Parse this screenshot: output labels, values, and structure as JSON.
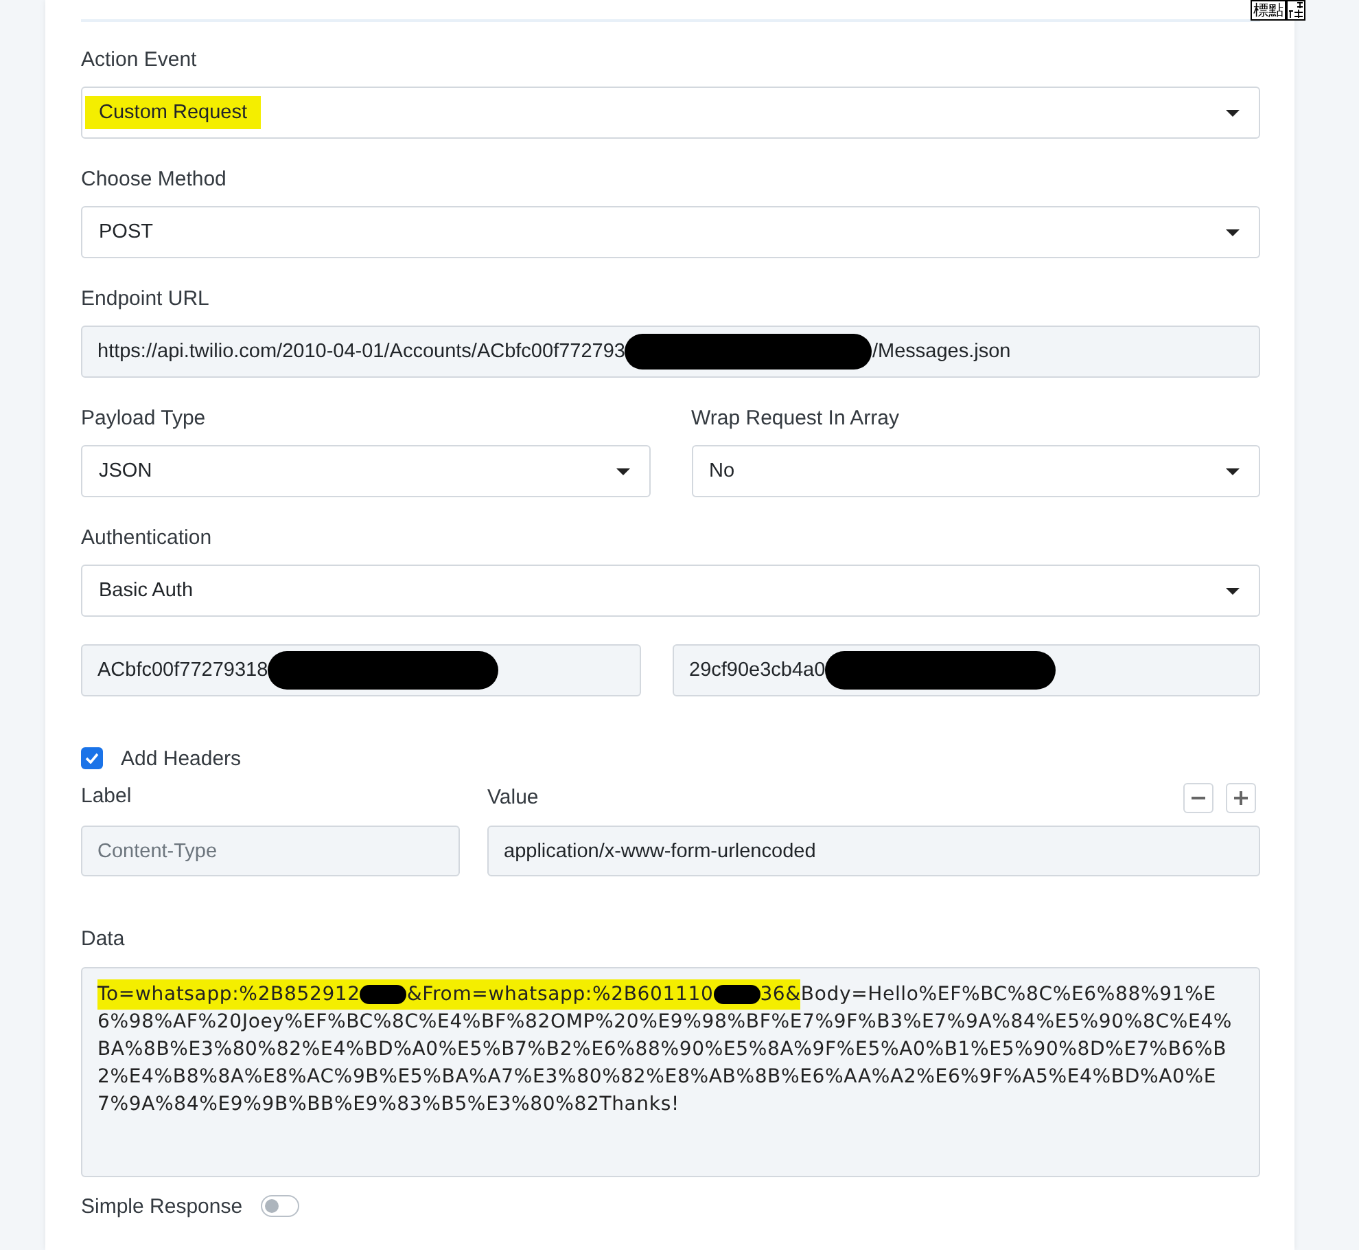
{
  "ime_indicator": {
    "label": "標點"
  },
  "action_event": {
    "label": "Action Event",
    "value": "Custom Request",
    "highlighted": true
  },
  "choose_method": {
    "label": "Choose Method",
    "value": "POST",
    "highlighted": false
  },
  "endpoint_url": {
    "label": "Endpoint URL",
    "value_parts": [
      {
        "kind": "text",
        "text": "https://api.twilio.com/2010-04-01/Accounts/ACbfc00f772793"
      },
      {
        "kind": "redaction"
      },
      {
        "kind": "text",
        "text": "/Messages.json"
      }
    ]
  },
  "payload_type": {
    "label": "Payload Type",
    "value": "JSON",
    "highlighted": false
  },
  "wrap_request_in_array": {
    "label": "Wrap Request In Array",
    "value": "No",
    "highlighted": false
  },
  "authentication": {
    "label": "Authentication",
    "value": "Basic Auth",
    "highlighted": false,
    "username_parts": [
      {
        "kind": "text",
        "text": "ACbfc00f77279318"
      },
      {
        "kind": "redaction"
      }
    ],
    "password_parts": [
      {
        "kind": "text",
        "text": "29cf90e3cb4a0"
      },
      {
        "kind": "redaction"
      }
    ]
  },
  "add_headers": {
    "label": "Add Headers",
    "checked": true
  },
  "headers": {
    "columns": [
      "Label",
      "Value"
    ],
    "rows": [
      {
        "label_placeholder": "Content-Type",
        "value": "application/x-www-form-urlencoded"
      }
    ]
  },
  "data": {
    "label": "Data",
    "value_parts": [
      {
        "kind": "text",
        "text": "To=whatsapp:%2B852912",
        "highlighted": true
      },
      {
        "kind": "redaction",
        "highlighted": true
      },
      {
        "kind": "text",
        "text": "&From=whatsapp:%2B601110",
        "highlighted": true
      },
      {
        "kind": "redaction",
        "highlighted": true
      },
      {
        "kind": "text",
        "text": "36&",
        "highlighted": true
      },
      {
        "kind": "text",
        "text": "Body=Hello%EF%BC%8C%E6%88%91%E6%98%AF%20Joey%EF%BC%8C%E4%BF%82OMP%20%E9%98%BF%E7%9F%B3%E7%9A%84%E5%90%8C%E4%BA%8B%E3%80%82%E4%BD%A0%E5%B7%B2%E6%88%90%E5%8A%9F%E5%A0%B1%E5%90%8D%E7%B6%B2%E4%B8%8A%E8%AC%9B%E5%BA%A7%E3%80%82%E8%AB%8B%E6%AA%A2%E6%9F%A5%E4%BD%A0%E7%9A%84%E9%9B%BB%E9%83%B5%E3%80%82Thanks!",
        "highlighted": false
      }
    ]
  },
  "simple_response": {
    "label": "Simple Response",
    "on": false
  }
}
